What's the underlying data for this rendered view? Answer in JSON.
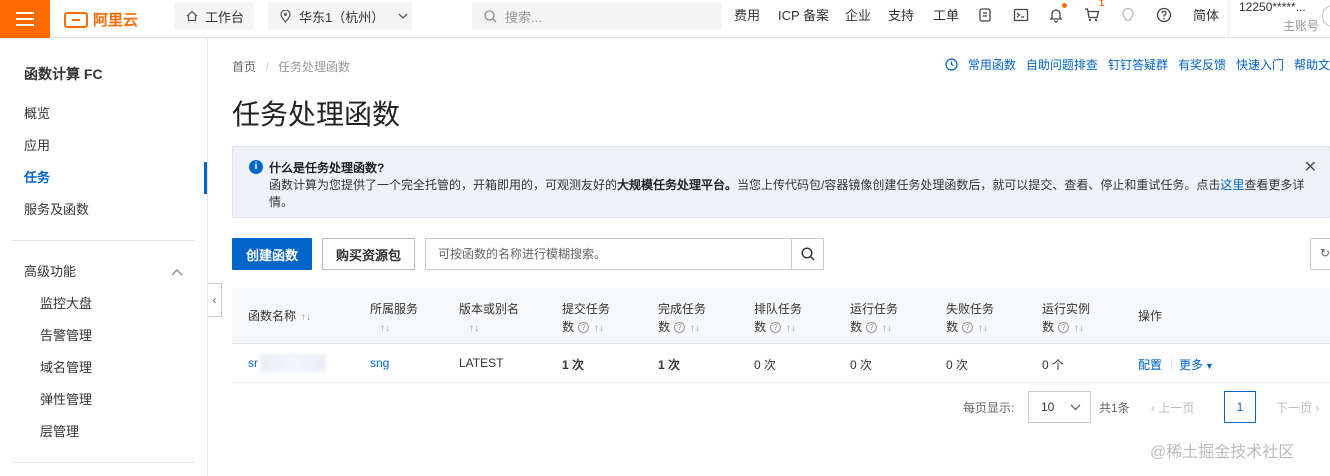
{
  "topbar": {
    "brand": "阿里云",
    "workspace": "工作台",
    "region": "华东1（杭州）",
    "search_placeholder": "搜索...",
    "nav": [
      "费用",
      "ICP 备案",
      "企业",
      "支持",
      "工单"
    ],
    "lang": "简体",
    "account_id": "12250*****...",
    "account_role": "主账号",
    "badge": "1"
  },
  "sidebar": {
    "title": "函数计算 FC",
    "items": [
      "概览",
      "应用",
      "任务",
      "服务及函数"
    ],
    "active": "任务",
    "advanced": "高级功能",
    "sub_items": [
      "监控大盘",
      "告警管理",
      "域名管理",
      "弹性管理",
      "层管理"
    ]
  },
  "breadcrumb": {
    "home": "首页",
    "current": "任务处理函数"
  },
  "quick_links": [
    "常用函数",
    "自助问题排查",
    "钉钉答疑群",
    "有奖反馈",
    "快速入门",
    "帮助文"
  ],
  "page_title": "任务处理函数",
  "info": {
    "title": "什么是任务处理函数?",
    "desc_pre": "函数计算为您提供了一个完全托管的，开箱即用的，可观测友好的",
    "desc_bold": "大规模任务处理平台。",
    "desc_mid": "当您上传代码包/容器镜像创建任务处理函数后，就可以提交、查看、停止和重试任务。点击",
    "desc_link": "这里",
    "desc_post": "查看更多详情。"
  },
  "toolbar": {
    "create": "创建函数",
    "buy": "购买资源包",
    "search_placeholder": "可按函数的名称进行模糊搜索。"
  },
  "table": {
    "headers": {
      "name": "函数名称",
      "service": "所属服务",
      "version": "版本或别名",
      "submitted1": "提交任务",
      "submitted2": "数",
      "completed1": "完成任务",
      "completed2": "数",
      "queued1": "排队任务",
      "queued2": "数",
      "running1": "运行任务",
      "running2": "数",
      "failed1": "失败任务",
      "failed2": "数",
      "instances1": "运行实例",
      "instances2": "数",
      "ops": "操作"
    },
    "row": {
      "name": "sr",
      "service": "sng",
      "version": "LATEST",
      "submitted": "1 次",
      "completed": "1 次",
      "queued": "0 次",
      "running": "0 次",
      "failed": "0 次",
      "instances": "0 个",
      "config": "配置",
      "more": "更多"
    }
  },
  "pagination": {
    "per_page_label": "每页显示:",
    "per_page": "10",
    "total": "共1条",
    "prev": "上一页",
    "page": "1",
    "next": "下一页"
  },
  "watermark": "@稀土掘金技术社区"
}
